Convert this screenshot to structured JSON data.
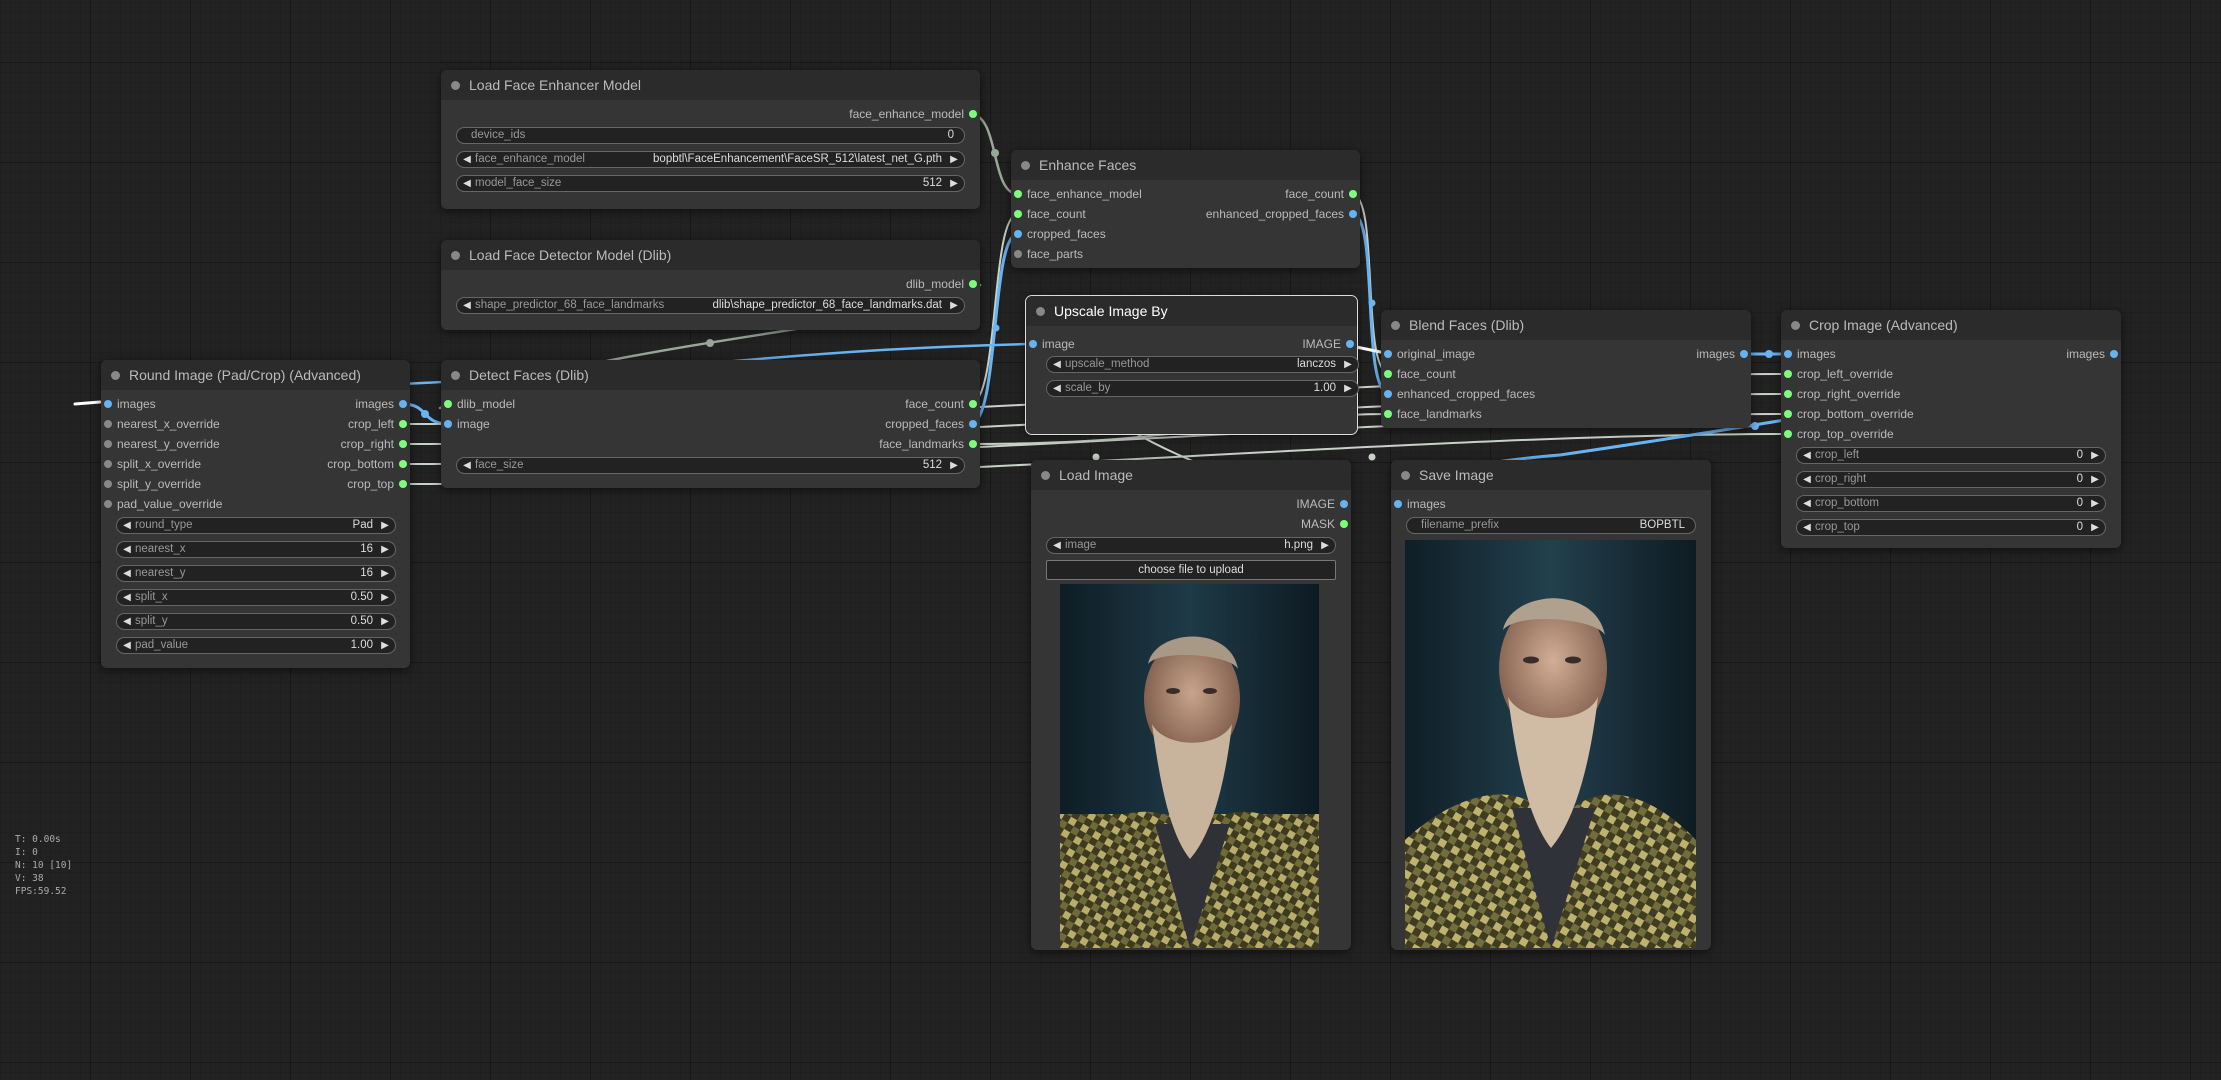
{
  "colors": {
    "background": "#222222",
    "node_body": "#353535",
    "node_title": "#2b2b2b",
    "slot_green": "#7dff7d",
    "slot_blue": "#65b3f0",
    "slot_gray": "#888888",
    "wire_blue": "#6ab4f3",
    "wire_light": "#c8d8c8"
  },
  "nodes": {
    "load_face_enhancer": {
      "title": "Load Face Enhancer Model",
      "outputs": [
        "face_enhance_model"
      ],
      "widgets": [
        {
          "label": "device_ids",
          "value": "0"
        },
        {
          "label": "face_enhance_model",
          "value": "bopbtl\\FaceEnhancement\\FaceSR_512\\latest_net_G.pth"
        },
        {
          "label": "model_face_size",
          "value": "512"
        }
      ]
    },
    "load_face_detector": {
      "title": "Load Face Detector Model (Dlib)",
      "outputs": [
        "dlib_model"
      ],
      "widgets": [
        {
          "label": "shape_predictor_68_face_landmarks",
          "value": "dlib\\shape_predictor_68_face_landmarks.dat"
        }
      ]
    },
    "enhance_faces": {
      "title": "Enhance Faces",
      "inputs": [
        "face_enhance_model",
        "face_count",
        "cropped_faces",
        "face_parts"
      ],
      "outputs": [
        "face_count",
        "enhanced_cropped_faces"
      ]
    },
    "upscale_image": {
      "title": "Upscale Image By",
      "inputs": [
        "image"
      ],
      "outputs": [
        "IMAGE"
      ],
      "widgets": [
        {
          "label": "upscale_method",
          "value": "lanczos"
        },
        {
          "label": "scale_by",
          "value": "1.00"
        }
      ]
    },
    "blend_faces": {
      "title": "Blend Faces (Dlib)",
      "inputs": [
        "original_image",
        "face_count",
        "enhanced_cropped_faces",
        "face_landmarks"
      ],
      "outputs": [
        "images"
      ]
    },
    "crop_image": {
      "title": "Crop Image (Advanced)",
      "inputs": [
        "images",
        "crop_left_override",
        "crop_right_override",
        "crop_bottom_override",
        "crop_top_override"
      ],
      "outputs": [
        "images"
      ],
      "widgets": [
        {
          "label": "crop_left",
          "value": "0"
        },
        {
          "label": "crop_right",
          "value": "0"
        },
        {
          "label": "crop_bottom",
          "value": "0"
        },
        {
          "label": "crop_top",
          "value": "0"
        }
      ]
    },
    "round_image": {
      "title": "Round Image (Pad/Crop) (Advanced)",
      "inputs": [
        "images",
        "nearest_x_override",
        "nearest_y_override",
        "split_x_override",
        "split_y_override",
        "pad_value_override"
      ],
      "outputs": [
        "images",
        "crop_left",
        "crop_right",
        "crop_bottom",
        "crop_top"
      ],
      "widgets": [
        {
          "label": "round_type",
          "value": "Pad"
        },
        {
          "label": "nearest_x",
          "value": "16"
        },
        {
          "label": "nearest_y",
          "value": "16"
        },
        {
          "label": "split_x",
          "value": "0.50"
        },
        {
          "label": "split_y",
          "value": "0.50"
        },
        {
          "label": "pad_value",
          "value": "1.00"
        }
      ]
    },
    "detect_faces": {
      "title": "Detect Faces (Dlib)",
      "inputs": [
        "dlib_model",
        "image"
      ],
      "outputs": [
        "face_count",
        "cropped_faces",
        "face_landmarks"
      ],
      "widgets": [
        {
          "label": "face_size",
          "value": "512"
        }
      ]
    },
    "load_image": {
      "title": "Load Image",
      "outputs": [
        "IMAGE",
        "MASK"
      ],
      "widgets": [
        {
          "label": "image",
          "value": "h.png"
        }
      ],
      "button": "choose file to upload"
    },
    "save_image": {
      "title": "Save Image",
      "inputs": [
        "images"
      ],
      "widgets": [
        {
          "label": "filename_prefix",
          "value": "BOPBTL"
        }
      ]
    }
  },
  "stats": {
    "t": "T: 0.00s",
    "i": "I: 0",
    "n": "N: 10 [10]",
    "v": "V: 38",
    "fps": "FPS:59.52"
  }
}
